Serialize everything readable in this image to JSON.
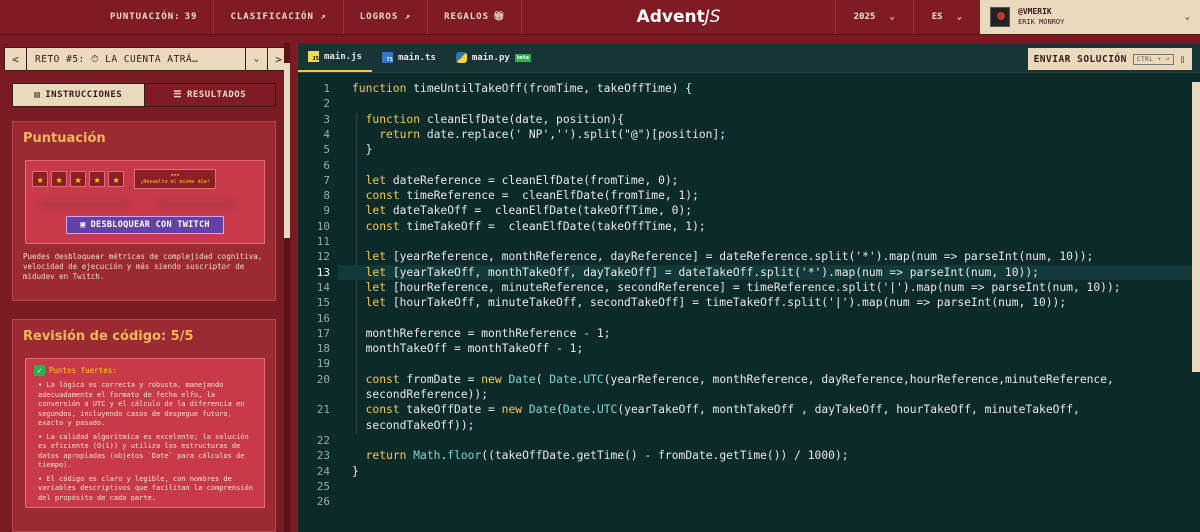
{
  "topbar": {
    "score_label": "PUNTUACIÓN:",
    "score_value": "39",
    "ranking": "CLASIFICACIÓN ↗",
    "achievements": "LOGROS ↗",
    "gifts": "REGALOS",
    "logo_bold": "Advent",
    "logo_rest": "JS",
    "year": "2025",
    "lang": "ES",
    "user_handle": "@VMERIK",
    "user_name": "ERIK MONROY"
  },
  "challenge_nav": {
    "title": "RETO #5: ⏱ LA CUENTA ATRÁ…",
    "prev": "<",
    "next": ">"
  },
  "tabs": {
    "instructions": "INSTRUCCIONES",
    "results": "RESULTADOS"
  },
  "score_card": {
    "title": "Puntuación",
    "stars": [
      "★",
      "★",
      "★",
      "★",
      "★"
    ],
    "badge_stars": "★★★",
    "badge_text": "¡Resuelto el mismo día!",
    "twitch_button": "DESBLOQUEAR CON TWITCH",
    "note": "Puedes desbloquear métricas de complejidad cognitiva, velocidad de ejecución y más siendo suscriptor de midudev en Twitch."
  },
  "review_card": {
    "title": "Revisión de código: 5/5",
    "strengths_label": "Puntos fuertes:",
    "bullets": [
      "• La lógica es correcta y robusta, manejando adecuadamente el formato de fecha elfo, la conversión a UTC y el cálculo de la diferencia en segundos, incluyendo casos de despegue futuro, exacto y pasado.",
      "• La calidad algorítmica es excelente; la solución es eficiente (O(1)) y utiliza las estructuras de datos apropiadas (objetos `Date` para cálculos de tiempo).",
      "• El código es claro y legible, con nombres de variables descriptivos que facilitan la comprensión del propósito de cada parte."
    ]
  },
  "editor": {
    "files": [
      {
        "name": "main.js",
        "icon": "JS",
        "type": "js"
      },
      {
        "name": "main.ts",
        "icon": "TS",
        "type": "ts"
      },
      {
        "name": "main.py",
        "icon": "",
        "type": "py",
        "badge": "beta"
      }
    ],
    "submit_label": "ENVIAR SOLUCIÓN",
    "shortcut": "CTRL + ⏎",
    "current_line": 13,
    "lines": [
      {
        "n": "1",
        "code": "function timeUntilTakeOff(fromTime, takeOffTime) {"
      },
      {
        "n": "2",
        "code": ""
      },
      {
        "n": "3",
        "code": "  function cleanElfDate(date, position){"
      },
      {
        "n": "4",
        "code": "    return date.replace(' NP','').split(\"@\")[position];"
      },
      {
        "n": "5",
        "code": "  }"
      },
      {
        "n": "6",
        "code": ""
      },
      {
        "n": "7",
        "code": "  let dateReference = cleanElfDate(fromTime, 0);"
      },
      {
        "n": "8",
        "code": "  const timeReference =  cleanElfDate(fromTime, 1);"
      },
      {
        "n": "9",
        "code": "  let dateTakeOff =  cleanElfDate(takeOffTime, 0);"
      },
      {
        "n": "10",
        "code": "  const timeTakeOff =  cleanElfDate(takeOffTime, 1);"
      },
      {
        "n": "11",
        "code": ""
      },
      {
        "n": "12",
        "code": "  let [yearReference, monthReference, dayReference] = dateReference.split('*').map(num => parseInt(num, 10));"
      },
      {
        "n": "13",
        "code": "  let [yearTakeOff, monthTakeOff, dayTakeOff] = dateTakeOff.split('*').map(num => parseInt(num, 10));"
      },
      {
        "n": "14",
        "code": "  let [hourReference, minuteReference, secondReference] = timeReference.split('|').map(num => parseInt(num, 10));"
      },
      {
        "n": "15",
        "code": "  let [hourTakeOff, minuteTakeOff, secondTakeOff] = timeTakeOff.split('|').map(num => parseInt(num, 10));"
      },
      {
        "n": "16",
        "code": ""
      },
      {
        "n": "17",
        "code": "  monthReference = monthReference - 1;"
      },
      {
        "n": "18",
        "code": "  monthTakeOff = monthTakeOff - 1;"
      },
      {
        "n": "19",
        "code": ""
      },
      {
        "n": "20",
        "code": "  const fromDate = new Date( Date.UTC(yearReference, monthReference, dayReference,hourReference,minuteReference,"
      },
      {
        "n": "",
        "code": "  secondReference));"
      },
      {
        "n": "21",
        "code": "  const takeOffDate = new Date(Date.UTC(yearTakeOff, monthTakeOff , dayTakeOff, hourTakeOff, minuteTakeOff,"
      },
      {
        "n": "",
        "code": "  secondTakeOff));"
      },
      {
        "n": "22",
        "code": ""
      },
      {
        "n": "23",
        "code": "  return Math.floor((takeOffDate.getTime() - fromDate.getTime()) / 1000);"
      },
      {
        "n": "24",
        "code": "}"
      },
      {
        "n": "25",
        "code": ""
      },
      {
        "n": "26",
        "code": ""
      }
    ]
  }
}
